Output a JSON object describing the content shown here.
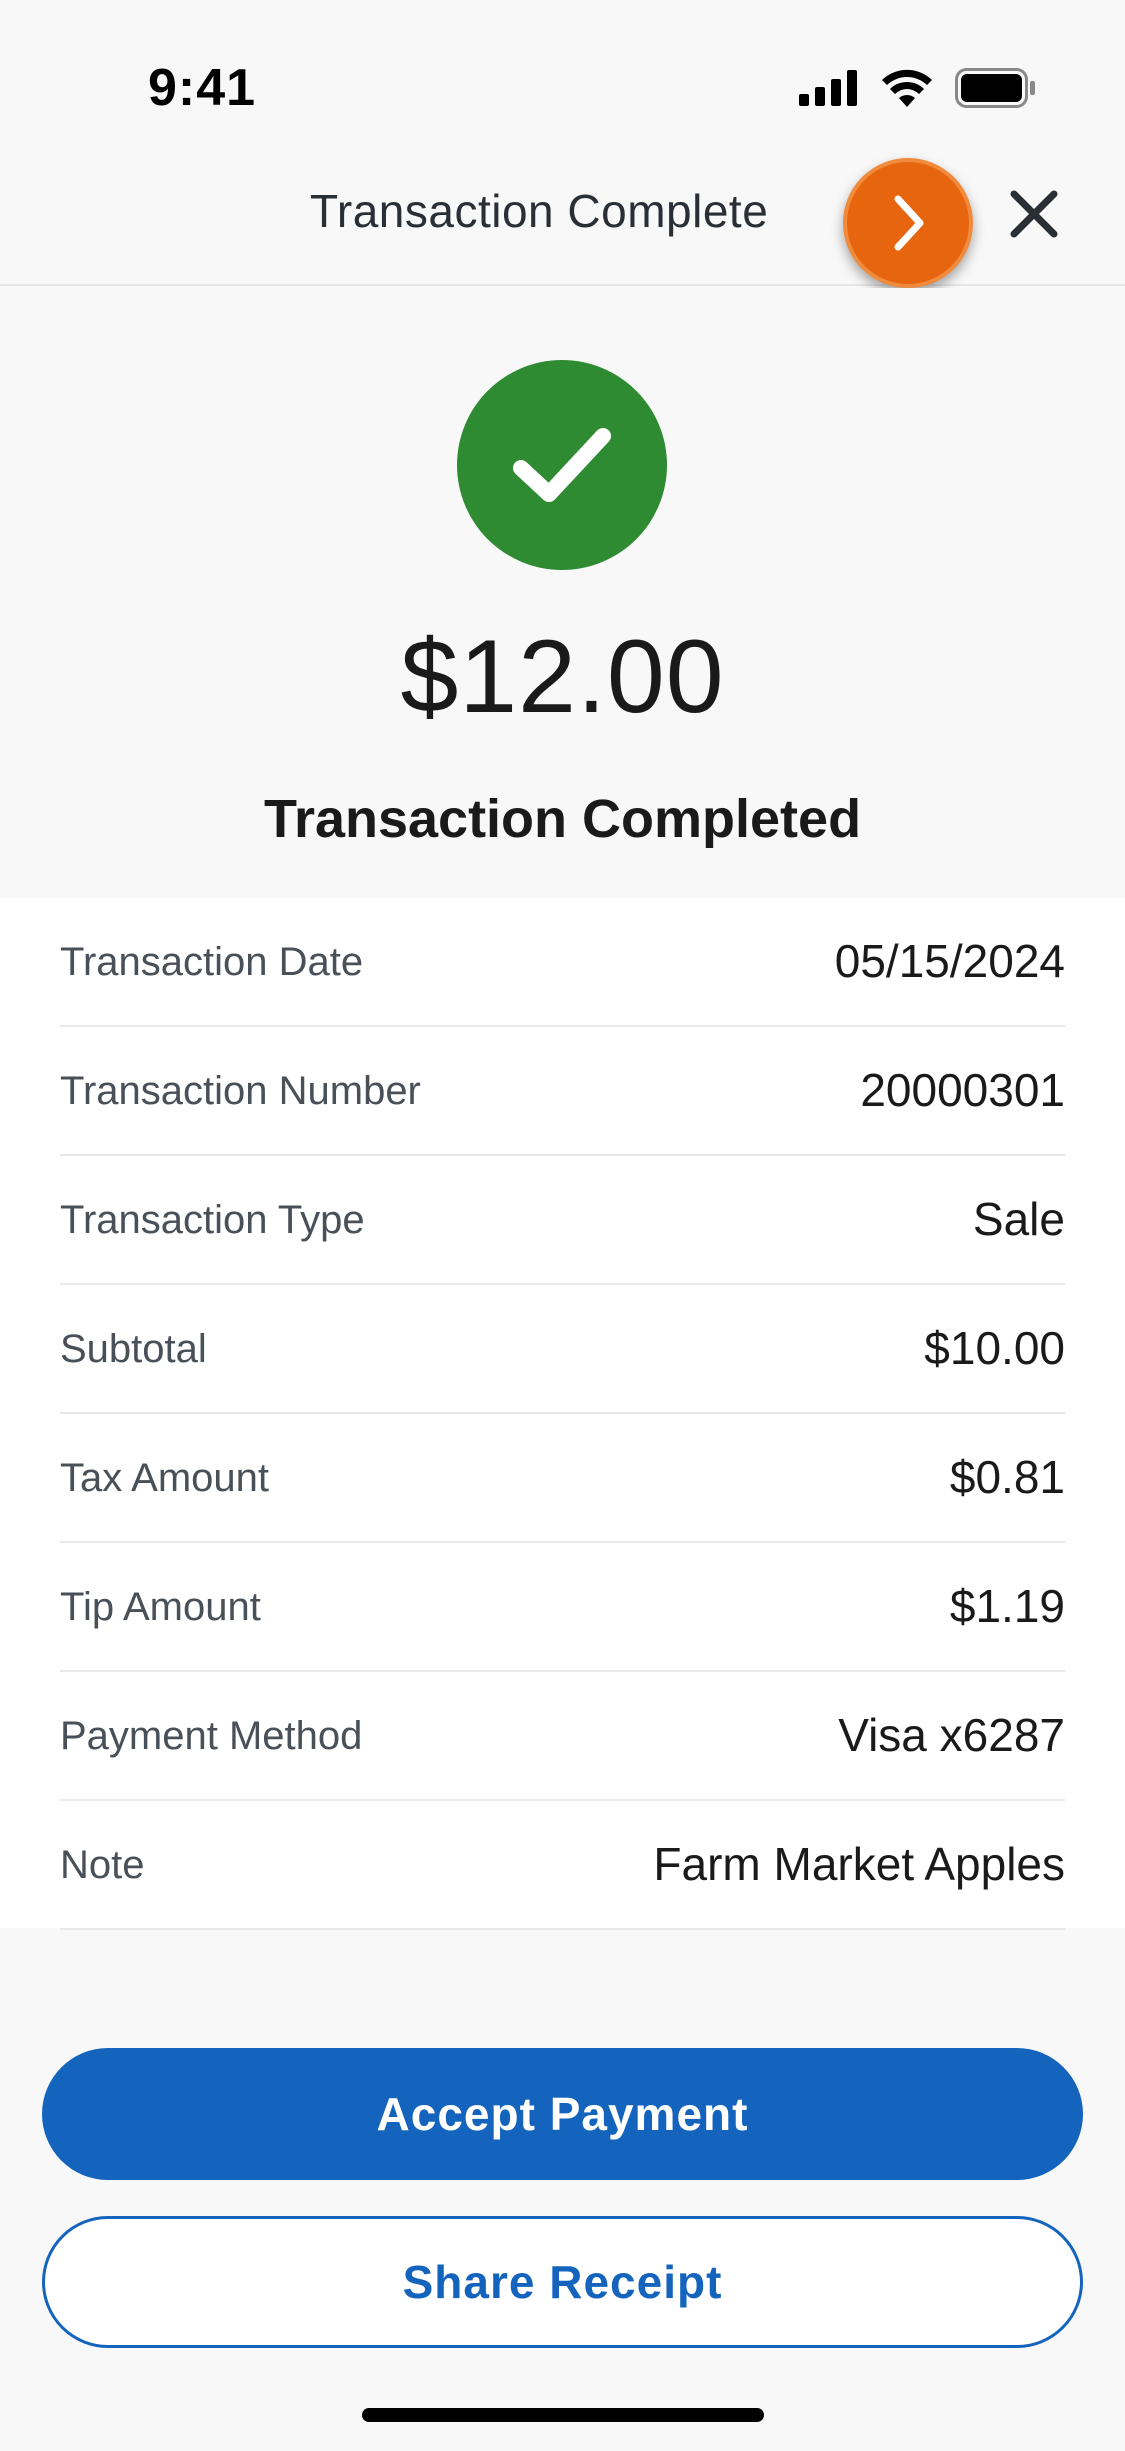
{
  "status_bar": {
    "time": "9:41",
    "icons": [
      "signal-icon",
      "wifi-icon",
      "battery-icon"
    ]
  },
  "header": {
    "title": "Transaction Complete",
    "next_icon": "chevron-right-icon",
    "close_icon": "close-icon",
    "accent_color": "#e8650f"
  },
  "hero": {
    "icon": "checkmark-icon",
    "icon_color": "#2e8b31",
    "amount": "$12.00",
    "status": "Transaction Completed"
  },
  "details": [
    {
      "label": "Transaction Date",
      "value": "05/15/2024"
    },
    {
      "label": "Transaction Number",
      "value": "20000301"
    },
    {
      "label": "Transaction Type",
      "value": "Sale"
    },
    {
      "label": "Subtotal",
      "value": "$10.00"
    },
    {
      "label": "Tax Amount",
      "value": "$0.81"
    },
    {
      "label": "Tip Amount",
      "value": "$1.19"
    },
    {
      "label": "Payment Method",
      "value": "Visa x6287"
    },
    {
      "label": "Note",
      "value": "Farm Market Apples"
    }
  ],
  "actions": {
    "accept_label": "Accept Payment",
    "share_label": "Share Receipt",
    "primary_color": "#1464be"
  }
}
